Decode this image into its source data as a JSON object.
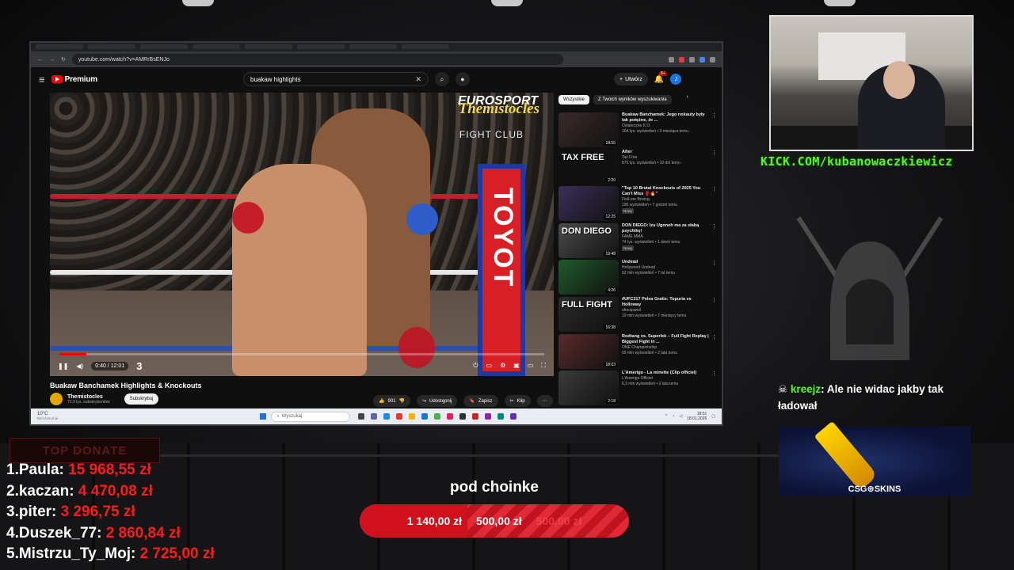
{
  "browser": {
    "url": "youtube.com/watch?v=AMRrBsENJo"
  },
  "youtube": {
    "logo_text": "Premium",
    "search_query": "buakaw highlights",
    "create_label": "Utwórz",
    "notif_count": "9+",
    "avatar_letter": "J"
  },
  "player": {
    "overlay_brand": "EUROSPORT",
    "overlay_channel": "Themistocles",
    "overlay_fightclub": "FIGHT CLUB",
    "ring_post_text": "TOYOT",
    "time": "0:40 / 12:01",
    "round_number": "3",
    "progress_fraction": 0.055
  },
  "video": {
    "title": "Buakaw Banchamek Highlights & Knockouts",
    "channel": "Themistocles",
    "subs": "72,9 tys. subskrybentów",
    "subscribe_label": "Subskrybuj",
    "likes": "901",
    "share_label": "Udostępnij",
    "save_label": "Zapisz",
    "clip_label": "Klip"
  },
  "chips": [
    "Wszystkie",
    "Z Twoich wyników wyszukiwania"
  ],
  "recs": [
    {
      "title": "Buakaw Banchamek: Jego nokauty były tak potężne, że ...",
      "channel": "Ostateczne K.O.",
      "meta": "164 tys. wyświetleń • 3 miesiące temu",
      "duration": "18:55",
      "thumb_text": "",
      "color": "#3a2a2a",
      "badge": ""
    },
    {
      "title": "After",
      "channel": "Tax Free",
      "meta": "875 tys. wyświetleń • 10 dni temu",
      "duration": "2:20",
      "thumb_text": "TAX FREE",
      "color": "#111111",
      "badge": ""
    },
    {
      "title": "\"Top 10 Brutal Knockouts of 2025 You Can't Miss 🥊🔥\"",
      "channel": "FistLore Boxing",
      "meta": "196 wyświetleń • 7 godzin temu",
      "duration": "12:25",
      "thumb_text": "",
      "color": "#3b2f5a",
      "badge": "Nowy"
    },
    {
      "title": "DON DIEGO: Izu Ugonoh ma za słabą psychikę!",
      "channel": "FAME MMA",
      "meta": "74 tys. wyświetleń • 1 dzień temu",
      "duration": "19:48",
      "thumb_text": "DON DIEGO",
      "color": "#4a4a4a",
      "badge": "Nowy"
    },
    {
      "title": "Undead",
      "channel": "Hollywood Undead",
      "meta": "62 mln wyświetleń • 7 lat temu",
      "duration": "4:26",
      "thumb_text": "",
      "color": "#1f5a2a",
      "badge": ""
    },
    {
      "title": "#UFC317 Pelea Gratis: Topuria vs Holloway",
      "channel": "ufcespanol",
      "meta": "10 mln wyświetleń • 7 miesięcy temu",
      "duration": "16:38",
      "thumb_text": "FULL FIGHT",
      "color": "#2a2a2a",
      "badge": ""
    },
    {
      "title": "Rodtang vs. Superlek – Full Fight Replay | Biggest Fight in ...",
      "channel": "ONE Championship",
      "meta": "69 mln wyświetleń • 2 lata temu",
      "duration": "18:03",
      "thumb_text": "",
      "color": "#5a2a2a",
      "badge": ""
    },
    {
      "title": "L'Amerigo - La minette (Clip officiel)",
      "channel": "L'Amerigo Officiel",
      "meta": "6,3 mln wyświetleń • 2 lata temu",
      "duration": "2:18",
      "thumb_text": "",
      "color": "#3a3a3a",
      "badge": ""
    }
  ],
  "taskbar": {
    "weather_temp": "10°C",
    "weather_desc": "Bezchmurnie",
    "search_placeholder": "Wyszukaj",
    "time": "18:51",
    "date": "18.01.2026"
  },
  "stream": {
    "kick_url": "KICK.COM/kubanowaczkiewicz",
    "chat_user": "kreejz",
    "chat_message": ": Ale nie widac jakby tak ładował",
    "sponsor": "CSG⊕SKINS",
    "top_donate_label": "TOP DONATE",
    "donors": [
      {
        "rank": "1.",
        "name": "Paula:",
        "amount": "15 968,55 zł"
      },
      {
        "rank": "2.",
        "name": "kaczan:",
        "amount": "4 470,08 zł"
      },
      {
        "rank": "3.",
        "name": "piter:",
        "amount": "3 296,75 zł"
      },
      {
        "rank": "4.",
        "name": "Duszek_77:",
        "amount": "2 860,84 zł"
      },
      {
        "rank": "5.",
        "name": "Mistrzu_Ty_Moj:",
        "amount": "2 725,00 zł"
      }
    ],
    "goal_title": "pod choinke",
    "goal_current": "1 140,00 zł",
    "goal_target": "500,00 zł",
    "goal_fraction": 1.0
  }
}
